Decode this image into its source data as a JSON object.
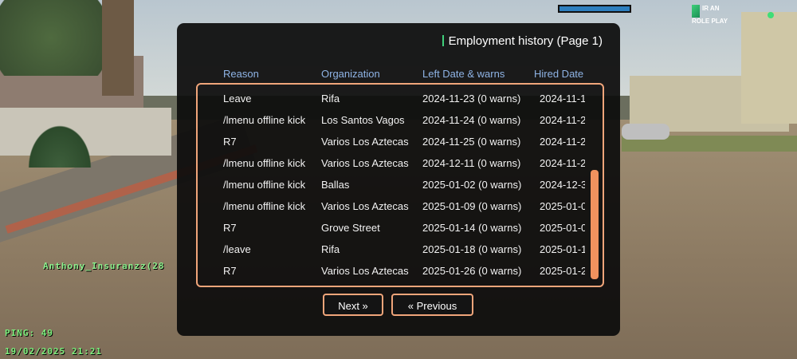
{
  "hud": {
    "logo_line1": "IR AN",
    "logo_line2": "ROLE PLAY",
    "player_tag": "Anthony_Insuranzz(28",
    "ping": "PING: 49",
    "datetime": "19/02/2025 21:21"
  },
  "dialog": {
    "title": "Employment history (Page 1)",
    "columns": [
      "Reason",
      "Organization",
      "Left Date & warns",
      "Hired Date"
    ],
    "rows": [
      {
        "reason": "Leave",
        "organization": "Rifa",
        "left": "2024-11-23 (0 warns)",
        "hired": "2024-11-1"
      },
      {
        "reason": "/lmenu offline kick",
        "organization": "Los Santos Vagos",
        "left": "2024-11-24 (0 warns)",
        "hired": "2024-11-2"
      },
      {
        "reason": "R7",
        "organization": "Varios Los Aztecas",
        "left": "2024-11-25 (0 warns)",
        "hired": "2024-11-2"
      },
      {
        "reason": "/lmenu offline kick",
        "organization": "Varios Los Aztecas",
        "left": "2024-12-11 (0 warns)",
        "hired": "2024-11-2"
      },
      {
        "reason": "/lmenu offline kick",
        "organization": "Ballas",
        "left": "2025-01-02 (0 warns)",
        "hired": "2024-12-3"
      },
      {
        "reason": "/lmenu offline kick",
        "organization": "Varios Los Aztecas",
        "left": "2025-01-09 (0 warns)",
        "hired": "2025-01-0"
      },
      {
        "reason": "R7",
        "organization": "Grove Street",
        "left": "2025-01-14 (0 warns)",
        "hired": "2025-01-0"
      },
      {
        "reason": "/leave",
        "organization": "Rifa",
        "left": "2025-01-18 (0 warns)",
        "hired": "2025-01-1"
      },
      {
        "reason": "R7",
        "organization": "Varios Los Aztecas",
        "left": "2025-01-26 (0 warns)",
        "hired": "2025-01-2"
      }
    ],
    "next_label": "Next »",
    "prev_label": "« Previous"
  },
  "colors": {
    "accent_border": "#f0a57a",
    "scrollbar": "#f0925e",
    "header_text": "#8fb4e6",
    "title_accent": "#3fd07a",
    "hud_text": "#7df07d"
  }
}
